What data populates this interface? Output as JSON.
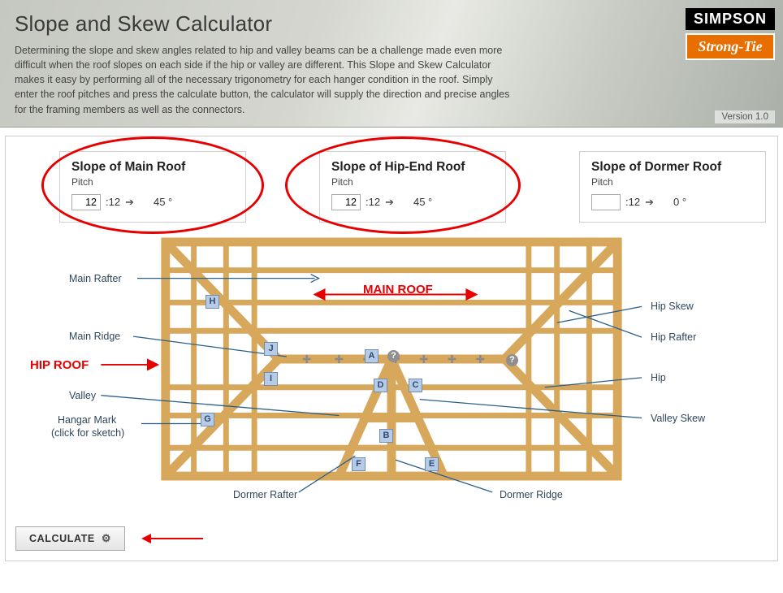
{
  "header": {
    "title": "Slope and Skew Calculator",
    "description": "Determining the slope and skew angles related to hip and valley beams can be a challenge made even more difficult when the roof slopes on each side if the hip or valley are different. This Slope and Skew Calculator makes it easy by performing all of the necessary trigonometry for each hanger condition in the roof. Simply enter the roof pitches and press the calculate button, the calculator will supply the direction and precise angles for the framing members as well as the connectors.",
    "brand_top": "SIMPSON",
    "brand_bottom": "Strong-Tie",
    "version": "Version 1.0"
  },
  "inputs": {
    "main": {
      "title": "Slope of Main Roof",
      "sub": "Pitch",
      "value": "12",
      "base": ":12",
      "angle": "45 °"
    },
    "hipend": {
      "title": "Slope of Hip-End Roof",
      "sub": "Pitch",
      "value": "12",
      "base": ":12",
      "angle": "45 °"
    },
    "dormer": {
      "title": "Slope of Dormer Roof",
      "sub": "Pitch",
      "value": "",
      "base": ":12",
      "angle": "0 °"
    }
  },
  "diagram": {
    "labels": {
      "main_rafter": "Main Rafter",
      "main_ridge": "Main Ridge",
      "valley": "Valley",
      "hangar_mark": "Hangar Mark",
      "hangar_sub": "(click for sketch)",
      "dormer_rafter": "Dormer Rafter",
      "dormer_ridge": "Dormer Ridge",
      "hip_skew": "Hip Skew",
      "hip_rafter": "Hip Rafter",
      "hip": "Hip",
      "valley_skew": "Valley Skew",
      "main_roof": "MAIN ROOF",
      "hip_roof": "HIP ROOF"
    },
    "markers": {
      "A": "A",
      "B": "B",
      "C": "C",
      "D": "D",
      "E": "E",
      "F": "F",
      "G": "G",
      "H": "H",
      "I": "I",
      "J": "J"
    }
  },
  "actions": {
    "calculate": "CALCULATE"
  }
}
